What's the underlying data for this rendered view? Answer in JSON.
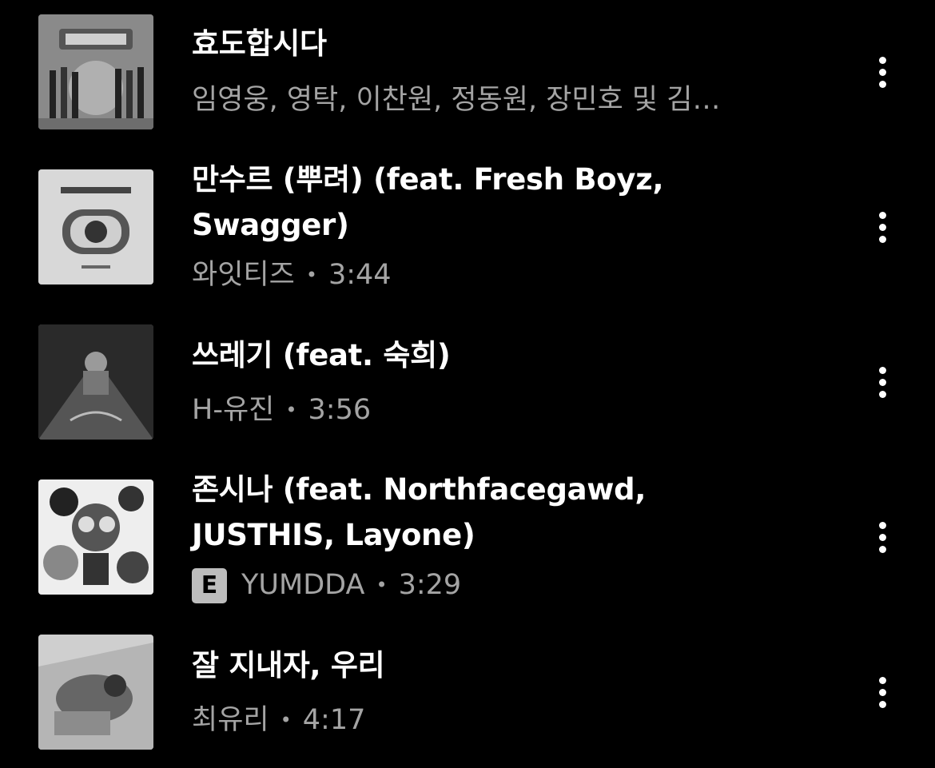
{
  "songs": [
    {
      "title": "효도합시다",
      "artist": "임영웅, 영탁, 이찬원, 정동원, 장민호 및 김…",
      "duration": "",
      "explicit": false
    },
    {
      "title": "만수르 (뿌려) (feat. Fresh Boyz, Swagger)",
      "artist": "와잇티즈",
      "duration": "3:44",
      "explicit": false
    },
    {
      "title": "쓰레기 (feat. 숙희)",
      "artist": "H-유진",
      "duration": "3:56",
      "explicit": false
    },
    {
      "title": "존시나 (feat. Northfacegawd, JUSTHIS, Layone)",
      "artist": "YUMDDA",
      "duration": "3:29",
      "explicit": true,
      "explicit_badge": "E"
    },
    {
      "title": "잘 지내자, 우리",
      "artist": "최유리",
      "duration": "4:17",
      "explicit": false
    }
  ],
  "separator": "•",
  "icons": {
    "more": "more-vertical-icon"
  }
}
